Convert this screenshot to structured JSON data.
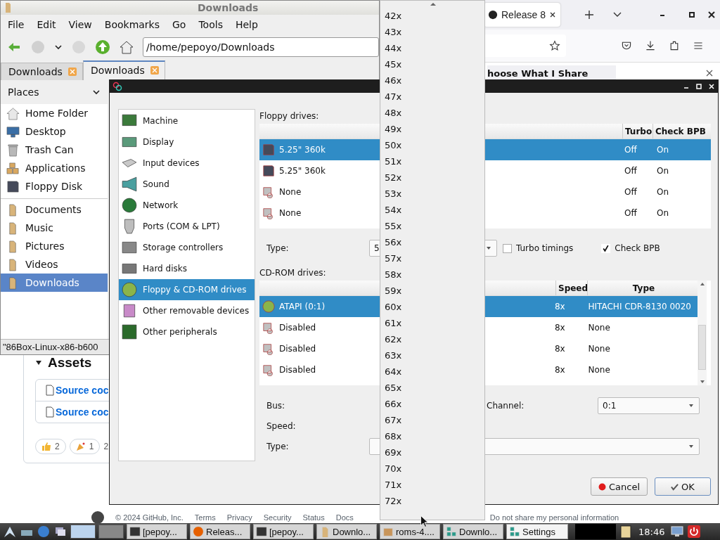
{
  "browser": {
    "tabs": [
      {
        "label": "Release 8",
        "selected": true
      }
    ],
    "notification": "hoose What I Share",
    "assets_heading": "Assets",
    "asset_links": [
      "Source coc",
      "Source coc"
    ],
    "reactions": [
      {
        "kind": "thumbs",
        "count": "2"
      },
      {
        "kind": "party",
        "count": "1"
      }
    ],
    "reactions_more": "2",
    "footer_left": [
      "© 2024 GitHub, Inc.",
      "Terms",
      "Privacy",
      "Security",
      "Status",
      "Docs"
    ],
    "footer_right": "Do not share my personal information"
  },
  "file_manager": {
    "title": "Downloads",
    "menu": [
      "File",
      "Edit",
      "View",
      "Bookmarks",
      "Go",
      "Tools",
      "Help"
    ],
    "path": "/home/pepoyo/Downloads",
    "tabs": [
      {
        "label": "Downloads",
        "selected": false
      },
      {
        "label": "Downloads",
        "selected": true
      }
    ],
    "places_label": "Places",
    "places": [
      {
        "label": "Home Folder",
        "kind": "home",
        "selected": false
      },
      {
        "label": "Desktop",
        "kind": "desktop",
        "selected": false
      },
      {
        "label": "Trash Can",
        "kind": "trash",
        "selected": false
      },
      {
        "label": "Applications",
        "kind": "apps",
        "selected": false
      },
      {
        "label": "Floppy Disk",
        "kind": "floppy",
        "selected": false
      },
      {
        "label": "Documents",
        "kind": "folder",
        "selected": false
      },
      {
        "label": "Music",
        "kind": "folder",
        "selected": false
      },
      {
        "label": "Pictures",
        "kind": "folder",
        "selected": false
      },
      {
        "label": "Videos",
        "kind": "folder",
        "selected": false
      },
      {
        "label": "Downloads",
        "kind": "folder",
        "selected": true
      }
    ],
    "status": "\"86Box-Linux-x86-b600"
  },
  "settings": {
    "categories": [
      {
        "label": "Machine",
        "kind": "machine",
        "selected": false
      },
      {
        "label": "Display",
        "kind": "display",
        "selected": false
      },
      {
        "label": "Input devices",
        "kind": "input",
        "selected": false
      },
      {
        "label": "Sound",
        "kind": "sound",
        "selected": false
      },
      {
        "label": "Network",
        "kind": "network",
        "selected": false
      },
      {
        "label": "Ports (COM & LPT)",
        "kind": "ports",
        "selected": false
      },
      {
        "label": "Storage controllers",
        "kind": "storage",
        "selected": false
      },
      {
        "label": "Hard disks",
        "kind": "hdd",
        "selected": false
      },
      {
        "label": "Floppy & CD-ROM drives",
        "kind": "floppy_cd",
        "selected": true
      },
      {
        "label": "Other removable devices",
        "kind": "removable",
        "selected": false
      },
      {
        "label": "Other peripherals",
        "kind": "peripherals",
        "selected": false
      }
    ],
    "floppy_label": "Floppy drives:",
    "floppy_columns": [
      "Turbo",
      "Check BPB"
    ],
    "floppy_rows": [
      {
        "name": "5.25\" 360k",
        "kind": "floppy",
        "turbo": "Off",
        "check_bpb": "On",
        "selected": true
      },
      {
        "name": "5.25\" 360k",
        "kind": "floppy",
        "turbo": "Off",
        "check_bpb": "On",
        "selected": false
      },
      {
        "name": "None",
        "kind": "none",
        "turbo": "Off",
        "check_bpb": "On",
        "selected": false
      },
      {
        "name": "None",
        "kind": "none",
        "turbo": "Off",
        "check_bpb": "On",
        "selected": false
      }
    ],
    "type_label": "Type:",
    "type_value": "5",
    "turbo_timings": {
      "label": "Turbo timings",
      "checked": false
    },
    "check_bpb": {
      "label": "Check BPB",
      "checked": true
    },
    "cdrom_label": "CD-ROM drives:",
    "cdrom_columns": [
      "Speed",
      "Type"
    ],
    "cdrom_rows": [
      {
        "name": "ATAPI (0:1)",
        "kind": "cd",
        "speed": "8x",
        "type": "HITACHI CDR-8130 0020",
        "selected": true
      },
      {
        "name": "Disabled",
        "kind": "disabled",
        "speed": "8x",
        "type": "None",
        "selected": false
      },
      {
        "name": "Disabled",
        "kind": "disabled",
        "speed": "8x",
        "type": "None",
        "selected": false
      },
      {
        "name": "Disabled",
        "kind": "disabled",
        "speed": "8x",
        "type": "None",
        "selected": false
      }
    ],
    "bus_label": "Bus:",
    "channel_label": "Channel:",
    "channel_value": "0:1",
    "speed_label": "Speed:",
    "cd_type_label": "Type:",
    "cancel": "Cancel",
    "ok": "OK"
  },
  "dropdown": {
    "items": [
      "42x",
      "43x",
      "44x",
      "45x",
      "46x",
      "47x",
      "48x",
      "49x",
      "50x",
      "51x",
      "52x",
      "53x",
      "54x",
      "55x",
      "56x",
      "57x",
      "58x",
      "59x",
      "60x",
      "61x",
      "62x",
      "63x",
      "64x",
      "65x",
      "66x",
      "67x",
      "68x",
      "69x",
      "70x",
      "71x",
      "72x"
    ]
  },
  "taskbar": {
    "tasks": [
      {
        "label": "[pepoy...",
        "kind": "terminal",
        "selected": false
      },
      {
        "label": "Releas...",
        "kind": "firefox",
        "selected": false
      },
      {
        "label": "[pepoy...",
        "kind": "terminal",
        "selected": false
      },
      {
        "label": "Downlo...",
        "kind": "folder",
        "selected": false
      },
      {
        "label": "roms-4....",
        "kind": "archive",
        "selected": false
      },
      {
        "label": "Downlo...",
        "kind": "app86",
        "selected": false
      },
      {
        "label": "Settings",
        "kind": "app86",
        "selected": true
      }
    ],
    "clock": "18:46"
  }
}
